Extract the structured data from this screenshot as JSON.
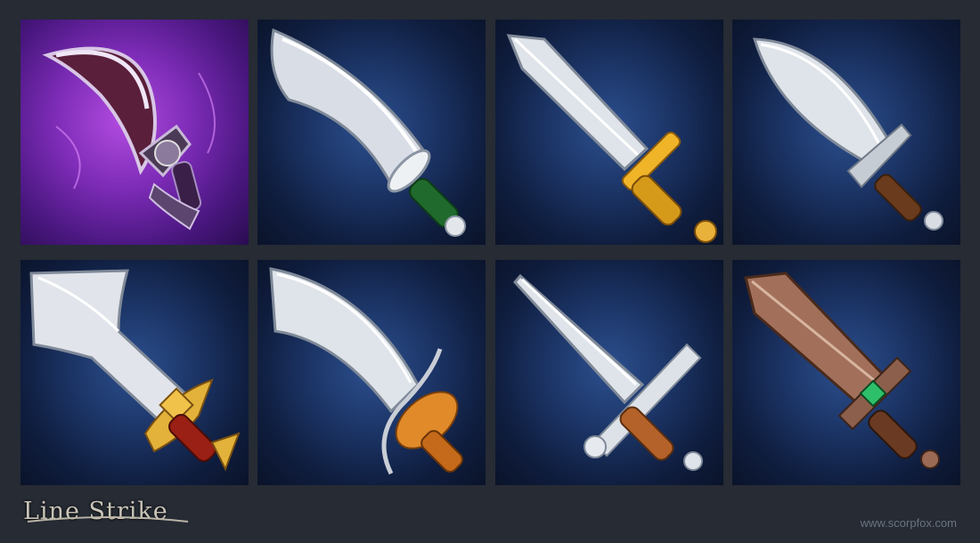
{
  "logo": {
    "text": "Line Strike"
  },
  "website": "www.scorpfox.com",
  "tiles": [
    {
      "name": "purple-scimitar-icon",
      "blade": "curved",
      "guard": "dark-skull",
      "glow": "#b24be0"
    },
    {
      "name": "curved-knife-icon",
      "blade": "curved-wide",
      "guard": "white-disc",
      "grip": "#1f6a2c"
    },
    {
      "name": "golden-guard-dagger-icon",
      "blade": "straight",
      "guard": "gold-bar",
      "grip": "#d69a1b"
    },
    {
      "name": "leaf-dagger-icon",
      "blade": "leaf",
      "guard": "steel",
      "grip": "#6a3b1d"
    },
    {
      "name": "broad-cleaver-icon",
      "blade": "broad",
      "guard": "gold-wings",
      "grip": "#9a1f14"
    },
    {
      "name": "basket-hilt-saber-icon",
      "blade": "saber",
      "guard": "basket",
      "grip": "#c46a1a"
    },
    {
      "name": "scroll-guard-dagger-icon",
      "blade": "thin",
      "guard": "scroll",
      "grip": "#b4622a"
    },
    {
      "name": "rusty-gem-dagger-icon",
      "blade": "rusty",
      "guard": "green-gem",
      "grip": "#6a3a22"
    }
  ],
  "colors": {
    "background": "#262b34",
    "tile": "#1c3567",
    "steel": "#dfe4ea"
  }
}
